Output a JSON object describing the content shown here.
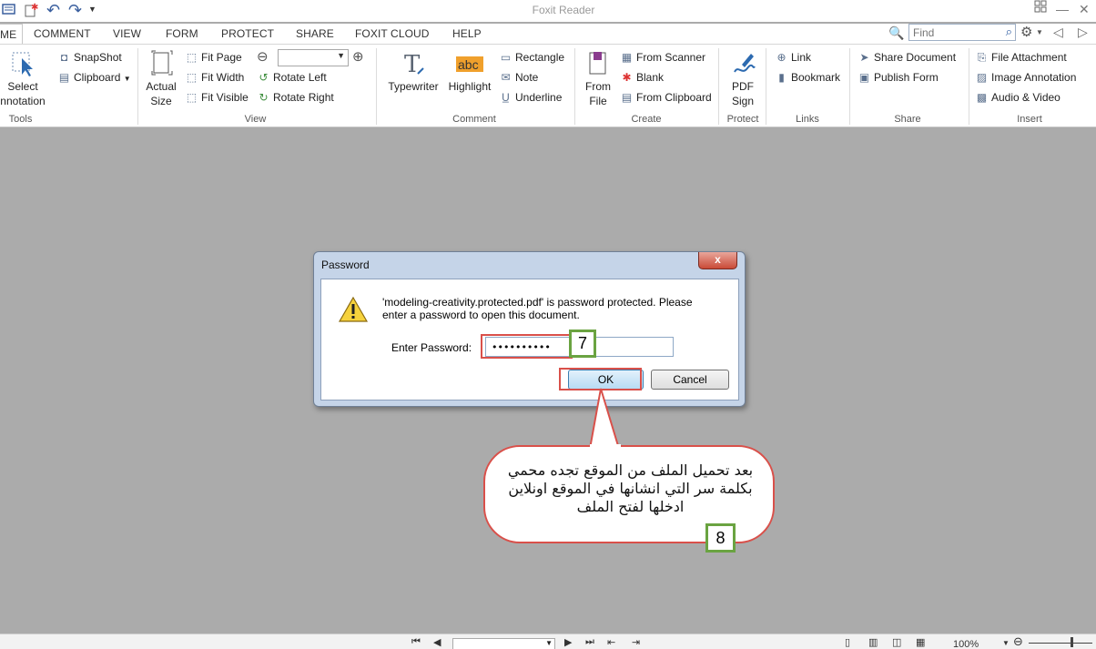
{
  "app": {
    "title": "Foxit Reader"
  },
  "quick_access": {
    "icons": [
      "app-menu-icon",
      "new-icon",
      "undo-icon",
      "redo-icon",
      "customize-icon"
    ]
  },
  "tabs": {
    "home": "ME",
    "comment": "COMMENT",
    "view": "VIEW",
    "form": "FORM",
    "protect": "PROTECT",
    "share": "SHARE",
    "foxit_cloud": "FOXIT CLOUD",
    "help": "HELP"
  },
  "find": {
    "placeholder": "Find"
  },
  "ribbon": {
    "tools": {
      "select_annotation_l1": "Select",
      "select_annotation_l2": "nnotation",
      "snapshot": "SnapShot",
      "clipboard": "Clipboard",
      "group": "Tools"
    },
    "view": {
      "actual_size_l1": "Actual",
      "actual_size_l2": "Size",
      "fit_page": "Fit Page",
      "fit_width": "Fit Width",
      "fit_visible": "Fit Visible",
      "rotate_left": "Rotate Left",
      "rotate_right": "Rotate Right",
      "group": "View"
    },
    "comment": {
      "typewriter": "Typewriter",
      "highlight": "Highlight",
      "highlight_icon_text": "abc",
      "rectangle": "Rectangle",
      "note": "Note",
      "underline": "Underline",
      "group": "Comment"
    },
    "create": {
      "from_file_l1": "From",
      "from_file_l2": "File",
      "from_scanner": "From Scanner",
      "blank": "Blank",
      "from_clipboard": "From Clipboard",
      "group": "Create"
    },
    "protect": {
      "pdf_sign_l1": "PDF",
      "pdf_sign_l2": "Sign",
      "group": "Protect"
    },
    "links": {
      "link": "Link",
      "bookmark": "Bookmark",
      "group": "Links"
    },
    "share": {
      "share_document": "Share Document",
      "publish_form": "Publish Form",
      "group": "Share"
    },
    "insert": {
      "file_attachment": "File Attachment",
      "image_annotation": "Image Annotation",
      "audio_video": "Audio & Video",
      "group": "Insert"
    }
  },
  "dialog": {
    "title": "Password",
    "close_label": "x",
    "message_l1": "'modeling-creativity.protected.pdf' is password protected. Please",
    "message_l2": "enter a password to open this document.",
    "password_label": "Enter Password:",
    "password_value": "••••••••••",
    "ok_label": "OK",
    "cancel_label": "Cancel"
  },
  "annotations": {
    "step7": "7",
    "step8": "8",
    "callout_text": "بعد تحميل الملف من الموقع تجده محمي بكلمة سر التي انشانها في الموقع اونلاين ادخلها لفتح الملف"
  },
  "statusbar": {
    "zoom": "100%"
  }
}
